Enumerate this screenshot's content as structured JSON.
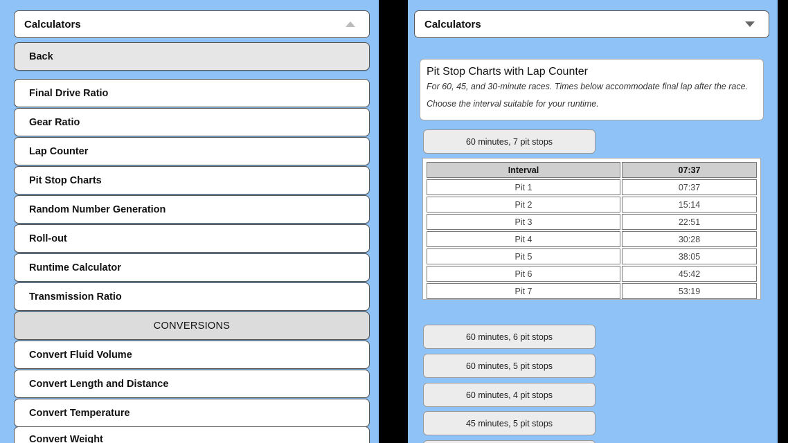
{
  "left": {
    "header": {
      "title": "Calculators"
    },
    "back_label": "Back",
    "items": [
      "Final Drive Ratio",
      "Gear Ratio",
      "Lap Counter",
      "Pit Stop Charts",
      "Random Number Generation",
      "Roll-out",
      "Runtime Calculator",
      "Transmission Ratio"
    ],
    "section_label": "CONVERSIONS",
    "conversions": [
      "Convert Fluid Volume",
      "Convert Length and Distance",
      "Convert Temperature",
      "Convert Weight"
    ]
  },
  "right": {
    "header": {
      "title": "Calculators"
    },
    "card": {
      "title": "Pit Stop Charts with Lap Counter",
      "description": "For 60, 45, and 30-minute races. Times below accommodate final lap after the race. Choose the interval suitable for your runtime."
    },
    "expanded_button": "60 minutes, 7 pit stops",
    "table": {
      "headers": [
        "Interval",
        "07:37"
      ],
      "rows": [
        [
          "Pit 1",
          "07:37"
        ],
        [
          "Pit 2",
          "15:14"
        ],
        [
          "Pit 3",
          "22:51"
        ],
        [
          "Pit 4",
          "30:28"
        ],
        [
          "Pit 5",
          "38:05"
        ],
        [
          "Pit 6",
          "45:42"
        ],
        [
          "Pit 7",
          "53:19"
        ]
      ]
    },
    "other_buttons": [
      "60 minutes, 6 pit stops",
      "60 minutes, 5 pit stops",
      "60 minutes, 4 pit stops",
      "45 minutes, 5 pit stops",
      ""
    ]
  },
  "colors": {
    "background": "#8fc3f7",
    "divider": "#000000"
  }
}
